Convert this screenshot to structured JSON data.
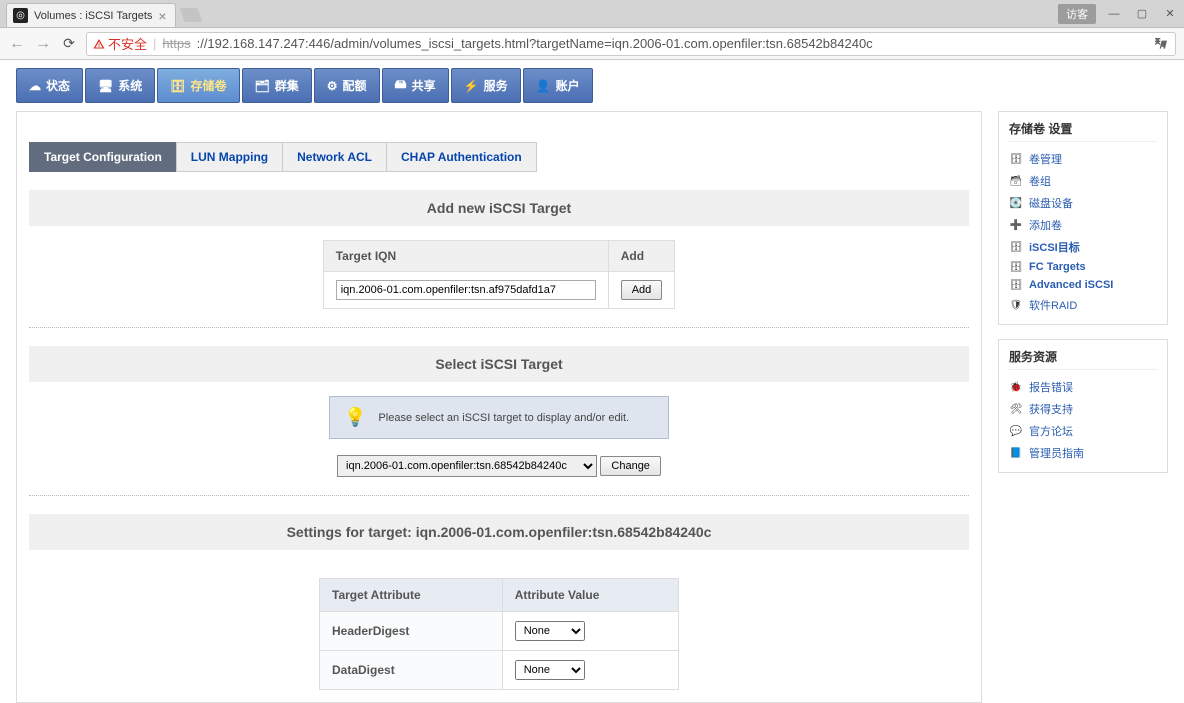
{
  "browser": {
    "tab_title": "Volumes : iSCSI Targets",
    "visitor_label": "访客",
    "insecure_label": "不安全",
    "url_prefix": "https",
    "url_rest": "://192.168.147.247:446/admin/volumes_iscsi_targets.html?targetName=iqn.2006-01.com.openfiler:tsn.68542b84240c"
  },
  "topnav": [
    {
      "icon": "☁",
      "label": "状态"
    },
    {
      "icon": "🖥",
      "label": "系统"
    },
    {
      "icon": "🗄",
      "label": "存储卷",
      "active": true
    },
    {
      "icon": "🗂",
      "label": "群集"
    },
    {
      "icon": "⚙",
      "label": "配额"
    },
    {
      "icon": "🖴",
      "label": "共享"
    },
    {
      "icon": "⚡",
      "label": "服务"
    },
    {
      "icon": "👤",
      "label": "账户"
    }
  ],
  "subtabs": [
    {
      "label": "Target Configuration",
      "active": true
    },
    {
      "label": "LUN Mapping"
    },
    {
      "label": "Network ACL"
    },
    {
      "label": "CHAP Authentication"
    }
  ],
  "add_section": {
    "heading": "Add new iSCSI Target",
    "iqn_header": "Target IQN",
    "add_header": "Add",
    "iqn_value": "iqn.2006-01.com.openfiler:tsn.af975dafd1a7",
    "add_btn": "Add"
  },
  "select_section": {
    "heading": "Select iSCSI Target",
    "info": "Please select an iSCSI target to display and/or edit.",
    "selected": "iqn.2006-01.com.openfiler:tsn.68542b84240c",
    "change_btn": "Change"
  },
  "settings_section": {
    "heading": "Settings for target: iqn.2006-01.com.openfiler:tsn.68542b84240c",
    "col_attr": "Target Attribute",
    "col_val": "Attribute Value",
    "rows": [
      {
        "attr": "HeaderDigest",
        "val": "None"
      },
      {
        "attr": "DataDigest",
        "val": "None"
      }
    ]
  },
  "sidebar": {
    "box1": {
      "title": "存储卷 设置",
      "items": [
        {
          "icon": "🗄",
          "label": "卷管理"
        },
        {
          "icon": "🗃",
          "label": "卷组"
        },
        {
          "icon": "💽",
          "label": "磁盘设备"
        },
        {
          "icon": "➕",
          "label": "添加卷"
        },
        {
          "icon": "🗄",
          "label": "iSCSI目标",
          "bold": true
        },
        {
          "icon": "🗄",
          "label": "FC Targets",
          "bold": true
        },
        {
          "icon": "🗄",
          "label": "Advanced iSCSI",
          "bold": true
        },
        {
          "icon": "🛡",
          "label": "软件RAID"
        }
      ]
    },
    "box2": {
      "title": "服务资源",
      "items": [
        {
          "icon": "🐞",
          "label": "报告错误"
        },
        {
          "icon": "🛠",
          "label": "获得支持"
        },
        {
          "icon": "💬",
          "label": "官方论坛"
        },
        {
          "icon": "📘",
          "label": "管理员指南"
        }
      ]
    }
  }
}
